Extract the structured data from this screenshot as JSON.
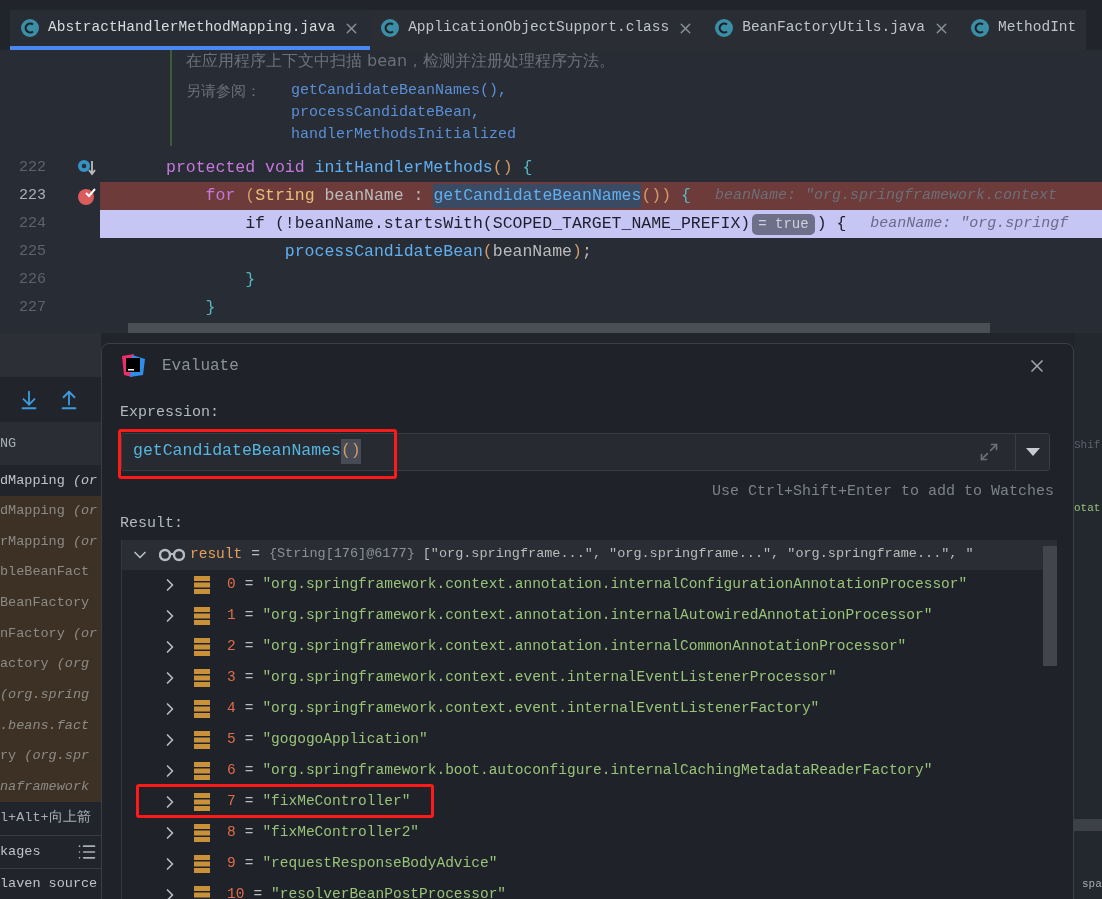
{
  "tabs": [
    {
      "label": "AbstractHandlerMethodMapping.java",
      "selected": true,
      "closable": true
    },
    {
      "label": "ApplicationObjectSupport.class",
      "selected": false,
      "closable": true
    },
    {
      "label": "BeanFactoryUtils.java",
      "selected": false,
      "closable": true
    },
    {
      "label": "MethodInt",
      "selected": false,
      "closable": false
    }
  ],
  "doc": {
    "description": "在应用程序上下文中扫描 bean，检测并注册处理程序方法。",
    "see_also_label": "另请参阅：",
    "see_also": [
      "getCandidateBeanNames(),",
      "processCandidateBean,",
      "handlerMethodsInitialized"
    ]
  },
  "code_lines": [
    {
      "number": "222",
      "step_marker": true,
      "breakpoint": false,
      "current": false,
      "tokens": [
        {
          "kind": "keyword",
          "text": "protected void"
        },
        {
          "kind": "method",
          "text": " initHandlerMethods"
        },
        {
          "kind": "paren",
          "text": "()"
        },
        {
          "kind": "brace",
          "text": " {"
        }
      ]
    },
    {
      "number": "223",
      "step_marker": false,
      "breakpoint": true,
      "current": false,
      "tokens": [
        {
          "kind": "keyword",
          "text": "    for"
        },
        {
          "kind": "paren",
          "text": " ("
        },
        {
          "kind": "type",
          "text": "String"
        },
        {
          "kind": "plain",
          "text": " beanName :"
        },
        {
          "kind": "selected",
          "text": "getCandidateBeanNames"
        },
        {
          "kind": "paren",
          "text": "())"
        },
        {
          "kind": "brace",
          "text": " {"
        },
        {
          "kind": "hint",
          "text": "beanName: \"org.springframework.context"
        }
      ]
    },
    {
      "number": "224",
      "step_marker": false,
      "breakpoint": false,
      "current": true,
      "tokens": [
        {
          "kind": "plain",
          "text": "        if (!beanName.startsWith(SCOPED_TARGET_NAME_PREFIX)"
        },
        {
          "kind": "badge",
          "text": "= true"
        },
        {
          "kind": "plain",
          "text": ") {"
        },
        {
          "kind": "hint",
          "text": "beanName: \"org.springf"
        }
      ]
    },
    {
      "number": "225",
      "step_marker": false,
      "breakpoint": false,
      "current": false,
      "tokens": [
        {
          "kind": "method",
          "text": "            processCandidateBean"
        },
        {
          "kind": "paren",
          "text": "("
        },
        {
          "kind": "plain",
          "text": "beanName"
        },
        {
          "kind": "paren",
          "text": ")"
        },
        {
          "kind": "plain",
          "text": ";"
        }
      ]
    },
    {
      "number": "226",
      "step_marker": false,
      "breakpoint": false,
      "current": false,
      "tokens": [
        {
          "kind": "brace",
          "text": "        }"
        }
      ]
    },
    {
      "number": "227",
      "step_marker": false,
      "breakpoint": false,
      "current": false,
      "tokens": [
        {
          "kind": "brace",
          "text": "    }"
        }
      ]
    }
  ],
  "left_panel": {
    "header": "NG",
    "frames": [
      {
        "text": "dMapping *(or*",
        "library": false
      },
      {
        "text": "dMapping *(or*",
        "library": true
      },
      {
        "text": "rMapping *(or*",
        "library": true
      },
      {
        "text": "bleBeanFact",
        "library": true
      },
      {
        "text": "BeanFactory",
        "library": true
      },
      {
        "text": "nFactory *(or*",
        "library": true
      },
      {
        "text": "actory *(org*",
        "library": true
      },
      {
        "text": "*(org.spring*",
        "library": true
      },
      {
        "text": "*.beans.fact*",
        "library": true
      },
      {
        "text": "ry *(org.spr*",
        "library": true
      },
      {
        "text": "*naframework*",
        "library": true
      }
    ],
    "hint": "l+Alt+向上箭",
    "packages_label": "kages",
    "source_label": "laven source"
  },
  "right_panel": {
    "field_text": "Shif",
    "row_text": "otat",
    "footer_text": "spa"
  },
  "dialog": {
    "title": "Evaluate",
    "expression_label": "Expression:",
    "expression": {
      "name": "getCandidateBeanNames",
      "parens": "()",
      "highlighted": true
    },
    "hint": "Use Ctrl+Shift+Enter to add to Watches",
    "result_label": "Result:",
    "result": {
      "name": "result",
      "operator": "=",
      "type": "{String[176]@6177}",
      "value": "[\"org.springframe...\", \"org.springframe...\", \"org.springframe...\", \"",
      "expanded": true,
      "children": [
        {
          "index": "0",
          "operator": "=",
          "value": "\"org.springframework.context.annotation.internalConfigurationAnnotationProcessor\"",
          "highlighted": false,
          "expanded": false
        },
        {
          "index": "1",
          "operator": "=",
          "value": "\"org.springframework.context.annotation.internalAutowiredAnnotationProcessor\"",
          "highlighted": false,
          "expanded": false
        },
        {
          "index": "2",
          "operator": "=",
          "value": "\"org.springframework.context.annotation.internalCommonAnnotationProcessor\"",
          "highlighted": false,
          "expanded": false
        },
        {
          "index": "3",
          "operator": "=",
          "value": "\"org.springframework.context.event.internalEventListenerProcessor\"",
          "highlighted": false,
          "expanded": false
        },
        {
          "index": "4",
          "operator": "=",
          "value": "\"org.springframework.context.event.internalEventListenerFactory\"",
          "highlighted": false,
          "expanded": false
        },
        {
          "index": "5",
          "operator": "=",
          "value": "\"gogogoApplication\"",
          "highlighted": false,
          "expanded": false
        },
        {
          "index": "6",
          "operator": "=",
          "value": "\"org.springframework.boot.autoconfigure.internalCachingMetadataReaderFactory\"",
          "highlighted": false,
          "expanded": false
        },
        {
          "index": "7",
          "operator": "=",
          "value": "\"fixMeController\"",
          "highlighted": true,
          "expanded": false
        },
        {
          "index": "8",
          "operator": "=",
          "value": "\"fixMeController2\"",
          "highlighted": false,
          "expanded": false
        },
        {
          "index": "9",
          "operator": "=",
          "value": "\"requestResponseBodyAdvice\"",
          "highlighted": false,
          "expanded": false
        },
        {
          "index": "10",
          "operator": "=",
          "value": "\"resolverBeanPostProcessor\"",
          "highlighted": false,
          "expanded": false
        }
      ]
    }
  }
}
